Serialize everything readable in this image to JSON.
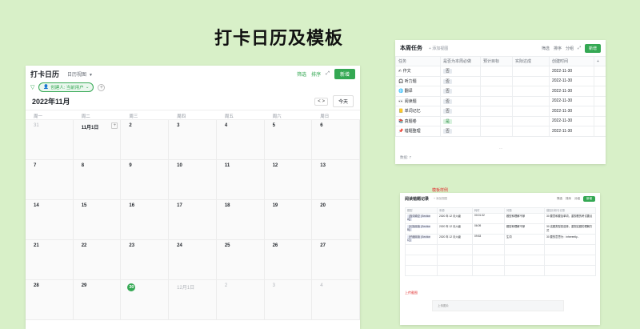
{
  "page_title": "打卡日历及模板",
  "calendar": {
    "title": "打卡日历",
    "view_label": "日历视图",
    "actions": {
      "filter": "筛选",
      "sort": "排序",
      "new": "新增"
    },
    "filter_chip": "创建人: 当前用户",
    "month": "2022年11月",
    "prev": "<",
    "next": ">",
    "today": "今天",
    "weekdays": [
      "周一",
      "周二",
      "周三",
      "周四",
      "周五",
      "周六",
      "周日"
    ],
    "weeks": [
      [
        "31",
        "11月1日",
        "2",
        "3",
        "4",
        "5",
        "6"
      ],
      [
        "7",
        "8",
        "9",
        "10",
        "11",
        "12",
        "13"
      ],
      [
        "14",
        "15",
        "16",
        "17",
        "18",
        "19",
        "20"
      ],
      [
        "21",
        "22",
        "23",
        "24",
        "25",
        "26",
        "27"
      ],
      [
        "28",
        "29",
        "30",
        "12月1日",
        "2",
        "3",
        "4"
      ]
    ],
    "today_day": "30"
  },
  "tasks": {
    "title": "本周任务",
    "add_view": "+ 添加视图",
    "actions": {
      "filter": "筛选",
      "sort": "排序",
      "group": "分组",
      "new": "新增"
    },
    "columns": [
      "任务",
      "是否为本周必做",
      "预计目标",
      "实际达成",
      "创建时间"
    ],
    "rows": [
      {
        "icon": "✍",
        "name": "作文",
        "required": "否",
        "created": "2022-11-30"
      },
      {
        "icon": "🎧",
        "name": "听力题",
        "required": "否",
        "created": "2022-11-30"
      },
      {
        "icon": "🌐",
        "name": "翻译",
        "required": "否",
        "created": "2022-11-30"
      },
      {
        "icon": "👀",
        "name": "阅读题",
        "required": "否",
        "created": "2022-11-30"
      },
      {
        "icon": "📒",
        "name": "单词记忆",
        "required": "否",
        "created": "2022-11-30"
      },
      {
        "icon": "📚",
        "name": "真题卷",
        "required": "是",
        "created": "2022-11-30"
      },
      {
        "icon": "📌",
        "name": "错题整理",
        "required": "否",
        "created": "2022-11-30"
      }
    ],
    "footer": "数据: 7"
  },
  "sample": {
    "label": "模板样例",
    "title": "阅读错题记录",
    "add_view": "+ 添加视图",
    "actions": {
      "filter": "筛选",
      "sort": "排序",
      "group": "分组",
      "new": "新增"
    },
    "columns": [
      "题型",
      "来源",
      "耗时",
      "问题",
      "错因分析与记录"
    ],
    "rows": [
      {
        "type": "[选词填空 (Section A)]",
        "source": "2020 年 12 月六级",
        "time": "00:01:32",
        "issue": "题型和理解不够",
        "note": "30 要意和要加单词，重视看的考试要点"
      },
      {
        "type": "[长篇阅读 (Section B)]",
        "source": "2020 年 12 月六级",
        "time": "06:09",
        "issue": "题型和理解不够",
        "note": "30 这题类型是选择，重视这题的理解方式"
      },
      {
        "type": "[仔细阅读 (Section C)]",
        "source": "2020 年 12 月六级",
        "time": "09:53",
        "issue": "生词",
        "note": "30 要的意思为：inherently..."
      }
    ],
    "upload_label": "上传截图",
    "upload_text": "上传图片"
  },
  "colors": {
    "accent": "#34a853",
    "background": "#d8f0c8"
  }
}
